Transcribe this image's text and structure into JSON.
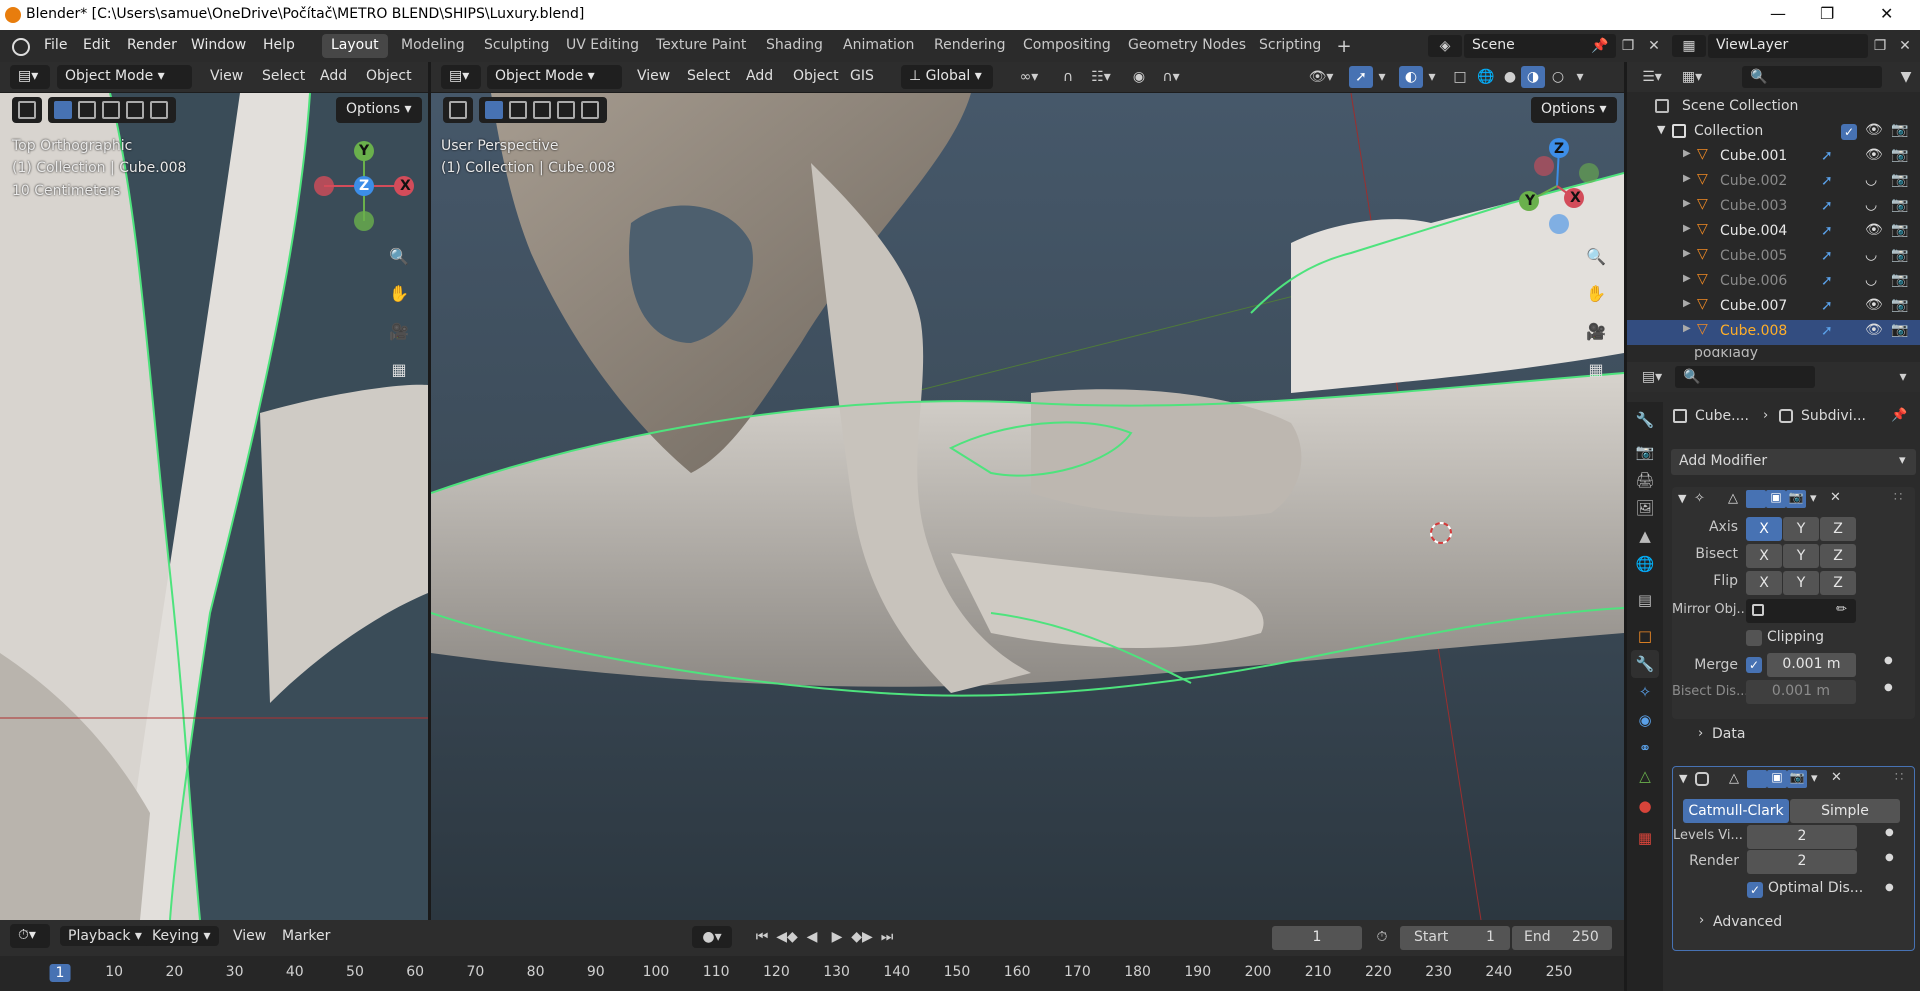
{
  "title_bar": {
    "title": "Blender* [C:\\Users\\samue\\OneDrive\\Počítač\\METRO BLEND\\SHIPS\\Luxury.blend]"
  },
  "menu": [
    "File",
    "Edit",
    "Render",
    "Window",
    "Help"
  ],
  "workspaces": [
    "Layout",
    "Modeling",
    "Sculpting",
    "UV Editing",
    "Texture Paint",
    "Shading",
    "Animation",
    "Rendering",
    "Compositing",
    "Geometry Nodes",
    "Scripting"
  ],
  "active_workspace": "Layout",
  "scene": "Scene",
  "view_layer": "ViewLayer",
  "left_viewport": {
    "mode": "Object Mode",
    "menus": [
      "View",
      "Select",
      "Add",
      "Object"
    ],
    "view_name": "Top Orthographic",
    "collection_info": "(1) Collection | Cube.008",
    "scale_info": "10 Centimeters",
    "options_label": "Options"
  },
  "main_viewport": {
    "mode": "Object Mode",
    "menus": [
      "View",
      "Select",
      "Add",
      "Object",
      "GIS"
    ],
    "orientation": "Global",
    "view_name": "User Perspective",
    "collection_info": "(1) Collection | Cube.008",
    "options_label": "Options"
  },
  "gizmo": {
    "x": "X",
    "y": "Y",
    "z": "Z"
  },
  "outliner": {
    "root": "Scene Collection",
    "collection": "Collection",
    "objects": [
      {
        "name": "Cube.001",
        "visible": true,
        "selected": false
      },
      {
        "name": "Cube.002",
        "visible": false,
        "selected": false
      },
      {
        "name": "Cube.003",
        "visible": false,
        "selected": false
      },
      {
        "name": "Cube.004",
        "visible": true,
        "selected": false
      },
      {
        "name": "Cube.005",
        "visible": false,
        "selected": false
      },
      {
        "name": "Cube.006",
        "visible": false,
        "selected": false
      },
      {
        "name": "Cube.007",
        "visible": true,
        "selected": false
      },
      {
        "name": "Cube.008",
        "visible": true,
        "selected": true
      }
    ],
    "next_collection": "podklady"
  },
  "properties": {
    "breadcrumb_object": "Cube....",
    "breadcrumb_modifier": "Subdivi...",
    "add_modifier": "Add Modifier",
    "mirror": {
      "axis_label": "Axis",
      "bisect_label": "Bisect",
      "flip_label": "Flip",
      "axes": [
        "X",
        "Y",
        "Z"
      ],
      "mirror_object_label": "Mirror Obj...",
      "clipping_label": "Clipping",
      "merge_label": "Merge",
      "merge_value": "0.001 m",
      "bisect_distance_label": "Bisect Dis...",
      "bisect_distance_value": "0.001 m",
      "data_label": "Data"
    },
    "subdivision": {
      "catmull_clark": "Catmull-Clark",
      "simple": "Simple",
      "levels_viewport_label": "Levels Vi...",
      "levels_viewport_value": "2",
      "render_label": "Render",
      "render_value": "2",
      "optimal_display_label": "Optimal Dis...",
      "advanced_label": "Advanced"
    }
  },
  "timeline": {
    "menus": [
      "Playback",
      "Keying",
      "View",
      "Marker"
    ],
    "current_frame": "1",
    "start_label": "Start",
    "start_value": "1",
    "end_label": "End",
    "end_value": "250",
    "ticks": [
      "1",
      "10",
      "20",
      "30",
      "40",
      "50",
      "60",
      "70",
      "80",
      "90",
      "100",
      "110",
      "120",
      "130",
      "140",
      "150",
      "160",
      "170",
      "180",
      "190",
      "200",
      "210",
      "220",
      "230",
      "240",
      "250"
    ]
  },
  "colors": {
    "accent": "#4772b3",
    "selection_outline": "#4ee37d",
    "active_object": "#ffaf29"
  }
}
